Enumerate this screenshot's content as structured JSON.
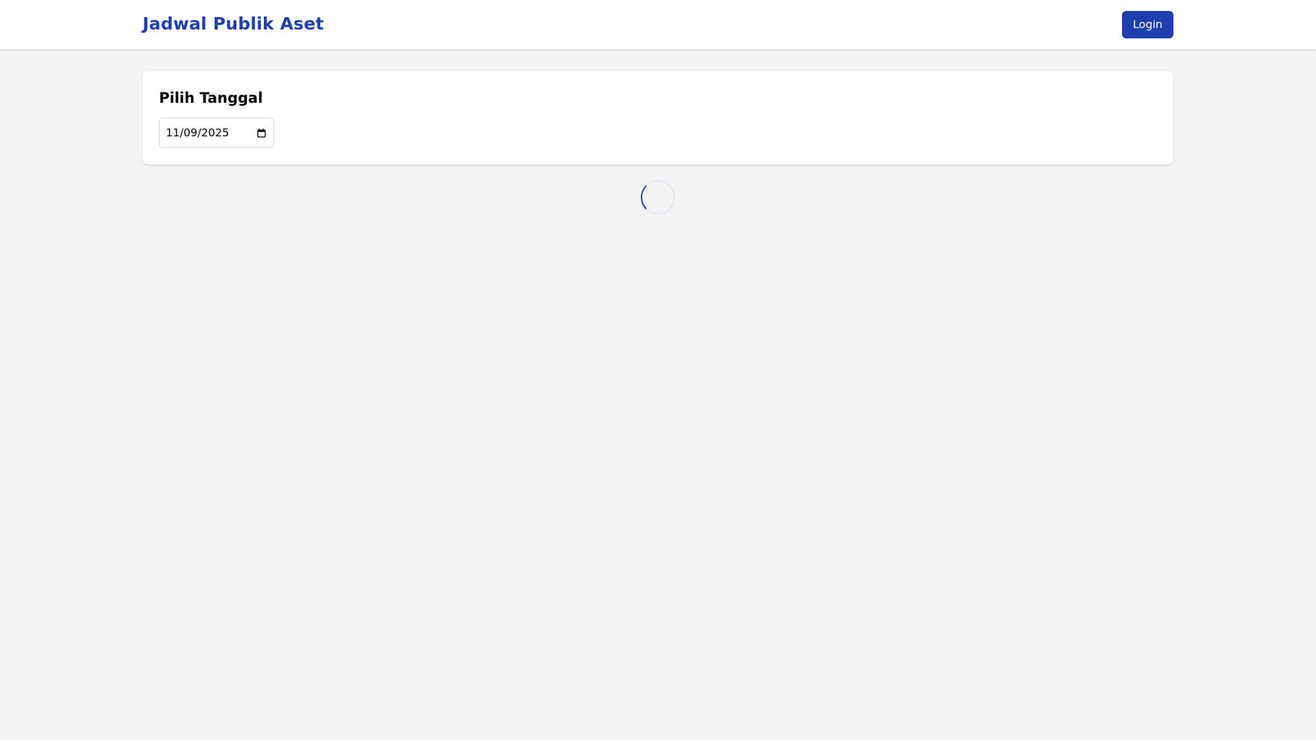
{
  "header": {
    "brand": "Jadwal Publik Aset",
    "login_label": "Login"
  },
  "date_picker": {
    "title": "Pilih Tanggal",
    "value": "11/09/2025",
    "icon": "calendar-icon"
  },
  "loading": {
    "icon": "loading-spinner"
  },
  "colors": {
    "brand": "#1e40af",
    "button_bg": "#1e40af",
    "page_bg": "#f3f4f6",
    "card_bg": "#ffffff"
  }
}
